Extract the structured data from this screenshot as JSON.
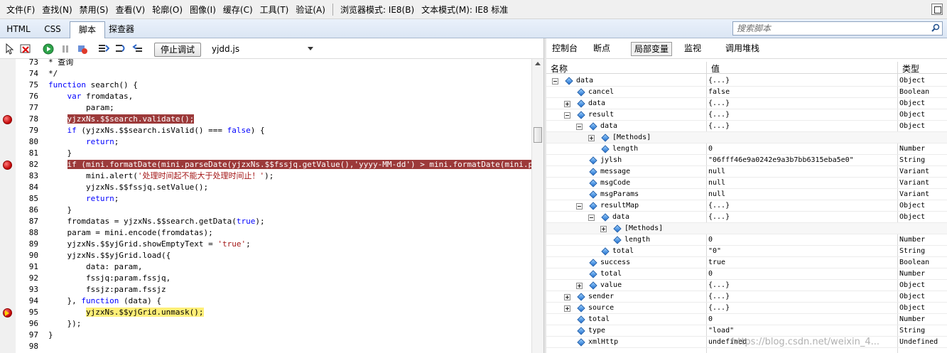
{
  "menubar": {
    "items": [
      "文件(F)",
      "查找(N)",
      "禁用(S)",
      "查看(V)",
      "轮廓(O)",
      "图像(I)",
      "缓存(C)",
      "工具(T)",
      "验证(A)"
    ],
    "browser_mode": "浏览器模式: IE8(B)",
    "doc_mode": "文本模式(M): IE8 标准"
  },
  "tabs": [
    "HTML",
    "CSS",
    "脚本",
    "探查器"
  ],
  "search": {
    "placeholder": "搜索脚本"
  },
  "toolbar": {
    "stop_debug_label": "停止调试",
    "file_name": "yjdd.js"
  },
  "right_tabs": [
    "控制台",
    "断点",
    "局部变量",
    "监视",
    "调用堆栈"
  ],
  "code_lines": [
    {
      "n": "73",
      "t": "* 查询"
    },
    {
      "n": "74",
      "t": "*/"
    },
    {
      "n": "75",
      "t": "function search() {"
    },
    {
      "n": "76",
      "t": "    var fromdatas,"
    },
    {
      "n": "77",
      "t": "        param;"
    },
    {
      "n": "78",
      "t": "    yjzxNs.$$search.validate();"
    },
    {
      "n": "79",
      "t": "    if (yjzxNs.$$search.isValid() === false) {"
    },
    {
      "n": "80",
      "t": "        return;"
    },
    {
      "n": "81",
      "t": "    }"
    },
    {
      "n": "82",
      "t": "    if (mini.formatDate(mini.parseDate(yjzxNs.$$fssjq.getValue(),'yyyy-MM-dd') > mini.formatDate(mini.parseDate("
    },
    {
      "n": "83",
      "t": "        mini.alert('处理时间起不能大于处理时间止！');"
    },
    {
      "n": "84",
      "t": "        yjzxNs.$$fssjq.setValue();"
    },
    {
      "n": "85",
      "t": "        return;"
    },
    {
      "n": "86",
      "t": "    }"
    },
    {
      "n": "87",
      "t": "    fromdatas = yjzxNs.$$search.getData(true);"
    },
    {
      "n": "88",
      "t": "    param = mini.encode(fromdatas);"
    },
    {
      "n": "89",
      "t": "    yjzxNs.$$yjGrid.showEmptyText = 'true';"
    },
    {
      "n": "90",
      "t": "    yjzxNs.$$yjGrid.load({"
    },
    {
      "n": "91",
      "t": "        data: param,"
    },
    {
      "n": "92",
      "t": "        fssjq:param.fssjq,"
    },
    {
      "n": "93",
      "t": "        fssjz:param.fssjz"
    },
    {
      "n": "94",
      "t": "    }, function (data) {"
    },
    {
      "n": "95",
      "t": "        yjzxNs.$$yjGrid.unmask();"
    },
    {
      "n": "96",
      "t": "    });"
    },
    {
      "n": "97",
      "t": "}"
    },
    {
      "n": "98",
      "t": ""
    }
  ],
  "locals": {
    "headers": {
      "name": "名称",
      "value": "值",
      "type": "类型"
    },
    "rows": [
      {
        "depth": 0,
        "exp": "minus",
        "name": "data",
        "value": "{...}",
        "type": "Object"
      },
      {
        "depth": 1,
        "exp": "",
        "name": "cancel",
        "value": "false",
        "type": "Boolean"
      },
      {
        "depth": 1,
        "exp": "plus",
        "name": "data",
        "value": "{...}",
        "type": "Object"
      },
      {
        "depth": 1,
        "exp": "minus",
        "name": "result",
        "value": "{...}",
        "type": "Object"
      },
      {
        "depth": 2,
        "exp": "minus",
        "name": "data",
        "value": "{...}",
        "type": "Object"
      },
      {
        "depth": 3,
        "exp": "plus",
        "name": "[Methods]",
        "value": "",
        "type": ""
      },
      {
        "depth": 3,
        "exp": "",
        "name": "length",
        "value": "0",
        "type": "Number"
      },
      {
        "depth": 2,
        "exp": "",
        "name": "jylsh",
        "value": "\"06fff46e9a0242e9a3b7bb6315eba5e0\"",
        "type": "String"
      },
      {
        "depth": 2,
        "exp": "",
        "name": "message",
        "value": "null",
        "type": "Variant"
      },
      {
        "depth": 2,
        "exp": "",
        "name": "msgCode",
        "value": "null",
        "type": "Variant"
      },
      {
        "depth": 2,
        "exp": "",
        "name": "msgParams",
        "value": "null",
        "type": "Variant"
      },
      {
        "depth": 2,
        "exp": "minus",
        "name": "resultMap",
        "value": "{...}",
        "type": "Object"
      },
      {
        "depth": 3,
        "exp": "minus",
        "name": "data",
        "value": "{...}",
        "type": "Object"
      },
      {
        "depth": 4,
        "exp": "plus",
        "name": "[Methods]",
        "value": "",
        "type": ""
      },
      {
        "depth": 4,
        "exp": "",
        "name": "length",
        "value": "0",
        "type": "Number"
      },
      {
        "depth": 3,
        "exp": "",
        "name": "total",
        "value": "\"0\"",
        "type": "String"
      },
      {
        "depth": 2,
        "exp": "",
        "name": "success",
        "value": "true",
        "type": "Boolean"
      },
      {
        "depth": 2,
        "exp": "",
        "name": "total",
        "value": "0",
        "type": "Number"
      },
      {
        "depth": 2,
        "exp": "plus",
        "name": "value",
        "value": "{...}",
        "type": "Object"
      },
      {
        "depth": 1,
        "exp": "plus",
        "name": "sender",
        "value": "{...}",
        "type": "Object"
      },
      {
        "depth": 1,
        "exp": "plus",
        "name": "source",
        "value": "{...}",
        "type": "Object"
      },
      {
        "depth": 1,
        "exp": "",
        "name": "total",
        "value": "0",
        "type": "Number"
      },
      {
        "depth": 1,
        "exp": "",
        "name": "type",
        "value": "\"load\"",
        "type": "String"
      },
      {
        "depth": 1,
        "exp": "",
        "name": "xmlHttp",
        "value": "undefined",
        "type": "Undefined"
      }
    ]
  },
  "watermark": "https://blog.csdn.net/weixin_4..."
}
